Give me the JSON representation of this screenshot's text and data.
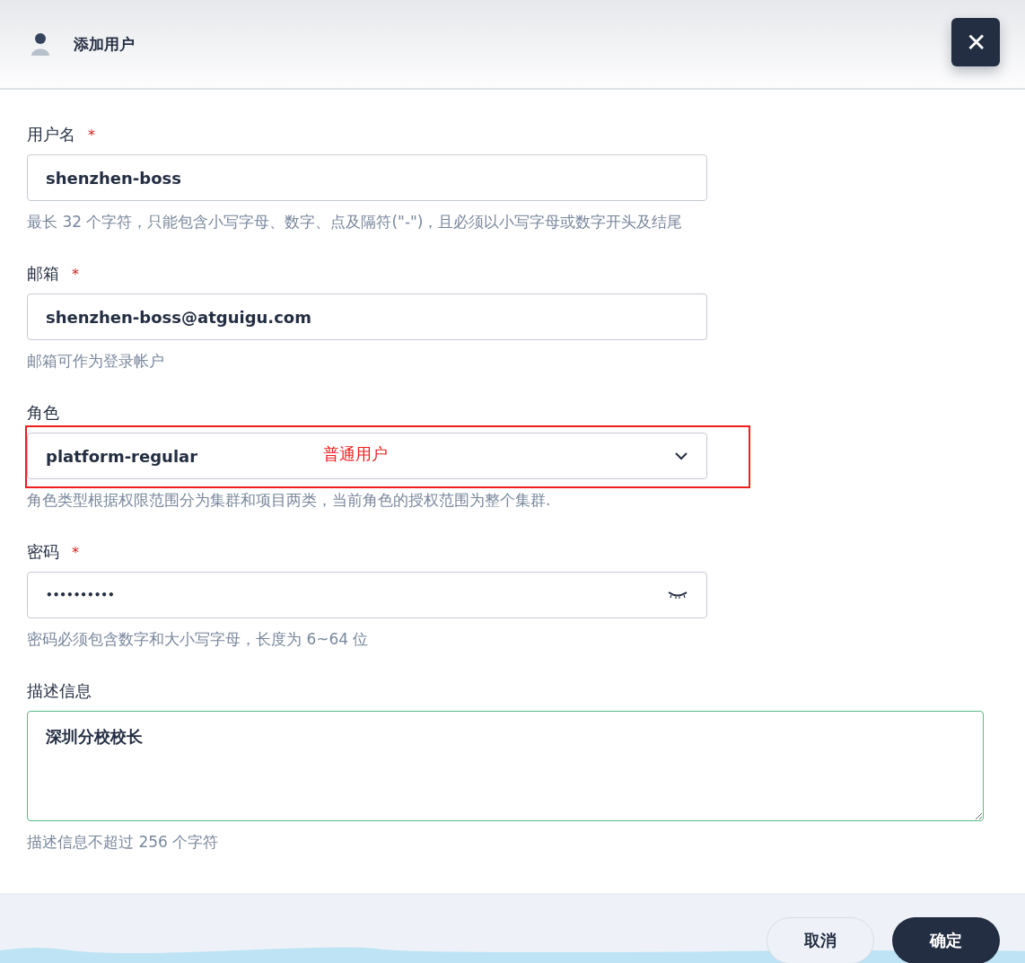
{
  "dialog": {
    "title": "添加用户",
    "close_label": "✕"
  },
  "fields": [
    {
      "kind": "text",
      "label": "用户名",
      "required_mark": "*",
      "value": "shenzhen-boss",
      "hint": "最长 32 个字符，只能包含小写字母、数字、点及隔符(\"-\")，且必须以小写字母或数字开头及结尾"
    },
    {
      "kind": "text",
      "label": "邮箱",
      "required_mark": "*",
      "value": "shenzhen-boss@atguigu.com",
      "hint": "邮箱可作为登录帐户"
    },
    {
      "kind": "select",
      "label": "角色",
      "value": "platform-regular",
      "hint": "角色类型根据权限范围分为集群和项目两类，当前角色的授权范围为整个集群.",
      "annotation": "普通用户"
    },
    {
      "kind": "password",
      "label": "密码",
      "required_mark": "*",
      "value": "••••••••••",
      "hint": "密码必须包含数字和大小写字母，长度为 6~64 位"
    },
    {
      "kind": "textarea",
      "label": "描述信息",
      "value": "深圳分校校长",
      "hint": "描述信息不超过 256 个字符"
    }
  ],
  "buttons": [
    {
      "label": "取消",
      "kind": "secondary"
    },
    {
      "label": "确定",
      "kind": "primary"
    }
  ]
}
